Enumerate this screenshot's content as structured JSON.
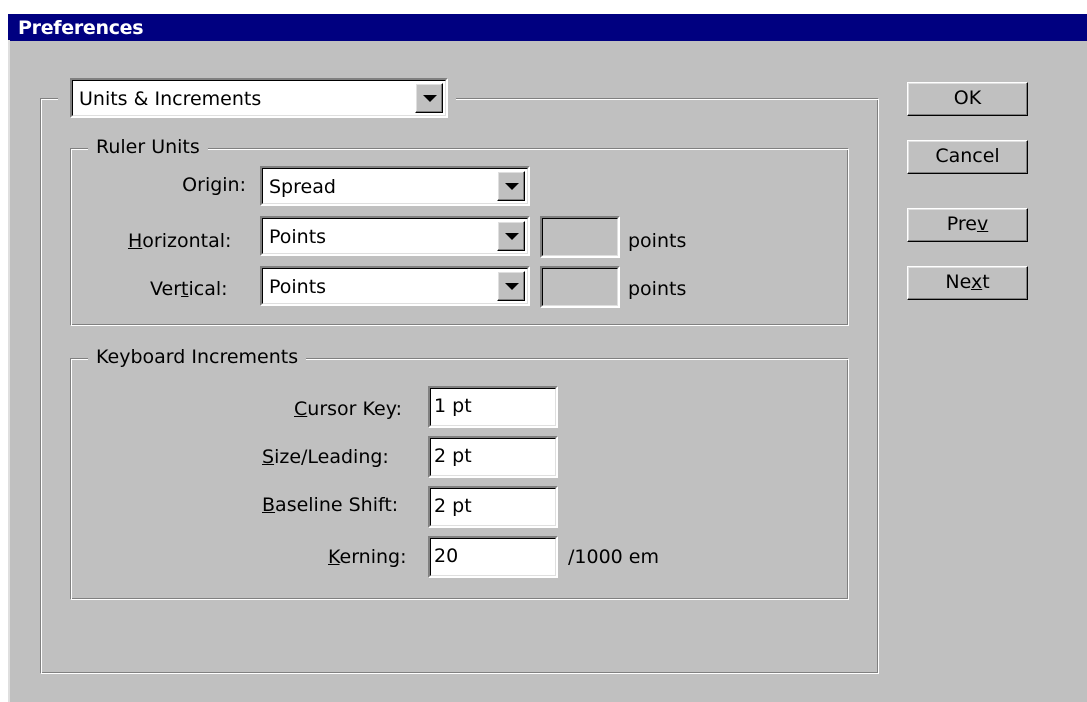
{
  "window": {
    "title": "Preferences"
  },
  "panel_select": {
    "value": "Units & Increments"
  },
  "ruler_units": {
    "legend": "Ruler Units",
    "origin": {
      "label": "Origin:",
      "value": "Spread"
    },
    "horizontal": {
      "label_pre": "",
      "label_ul": "H",
      "label_post": "orizontal:",
      "value": "Points",
      "custom_value": "",
      "unit": "points"
    },
    "vertical": {
      "label_pre": "Ver",
      "label_ul": "t",
      "label_post": "ical:",
      "value": "Points",
      "custom_value": "",
      "unit": "points"
    }
  },
  "keyboard_increments": {
    "legend": "Keyboard Increments",
    "cursor_key": {
      "label_ul": "C",
      "label_post": "ursor Key:",
      "value": "1 pt"
    },
    "size_leading": {
      "label_ul": "S",
      "label_post": "ize/Leading:",
      "value": "2 pt"
    },
    "baseline_shift": {
      "label_ul": "B",
      "label_post": "aseline Shift:",
      "value": "2 pt"
    },
    "kerning": {
      "label_ul": "K",
      "label_post": "erning:",
      "value": "20",
      "unit": "/1000 em"
    }
  },
  "buttons": {
    "ok": "OK",
    "cancel": "Cancel",
    "prev": {
      "pre": "Pre",
      "ul": "v",
      "post": ""
    },
    "next": {
      "pre": "Ne",
      "ul": "x",
      "post": "t"
    }
  },
  "colors": {
    "titlebar": "#000080",
    "face": "#c0c0c0"
  }
}
